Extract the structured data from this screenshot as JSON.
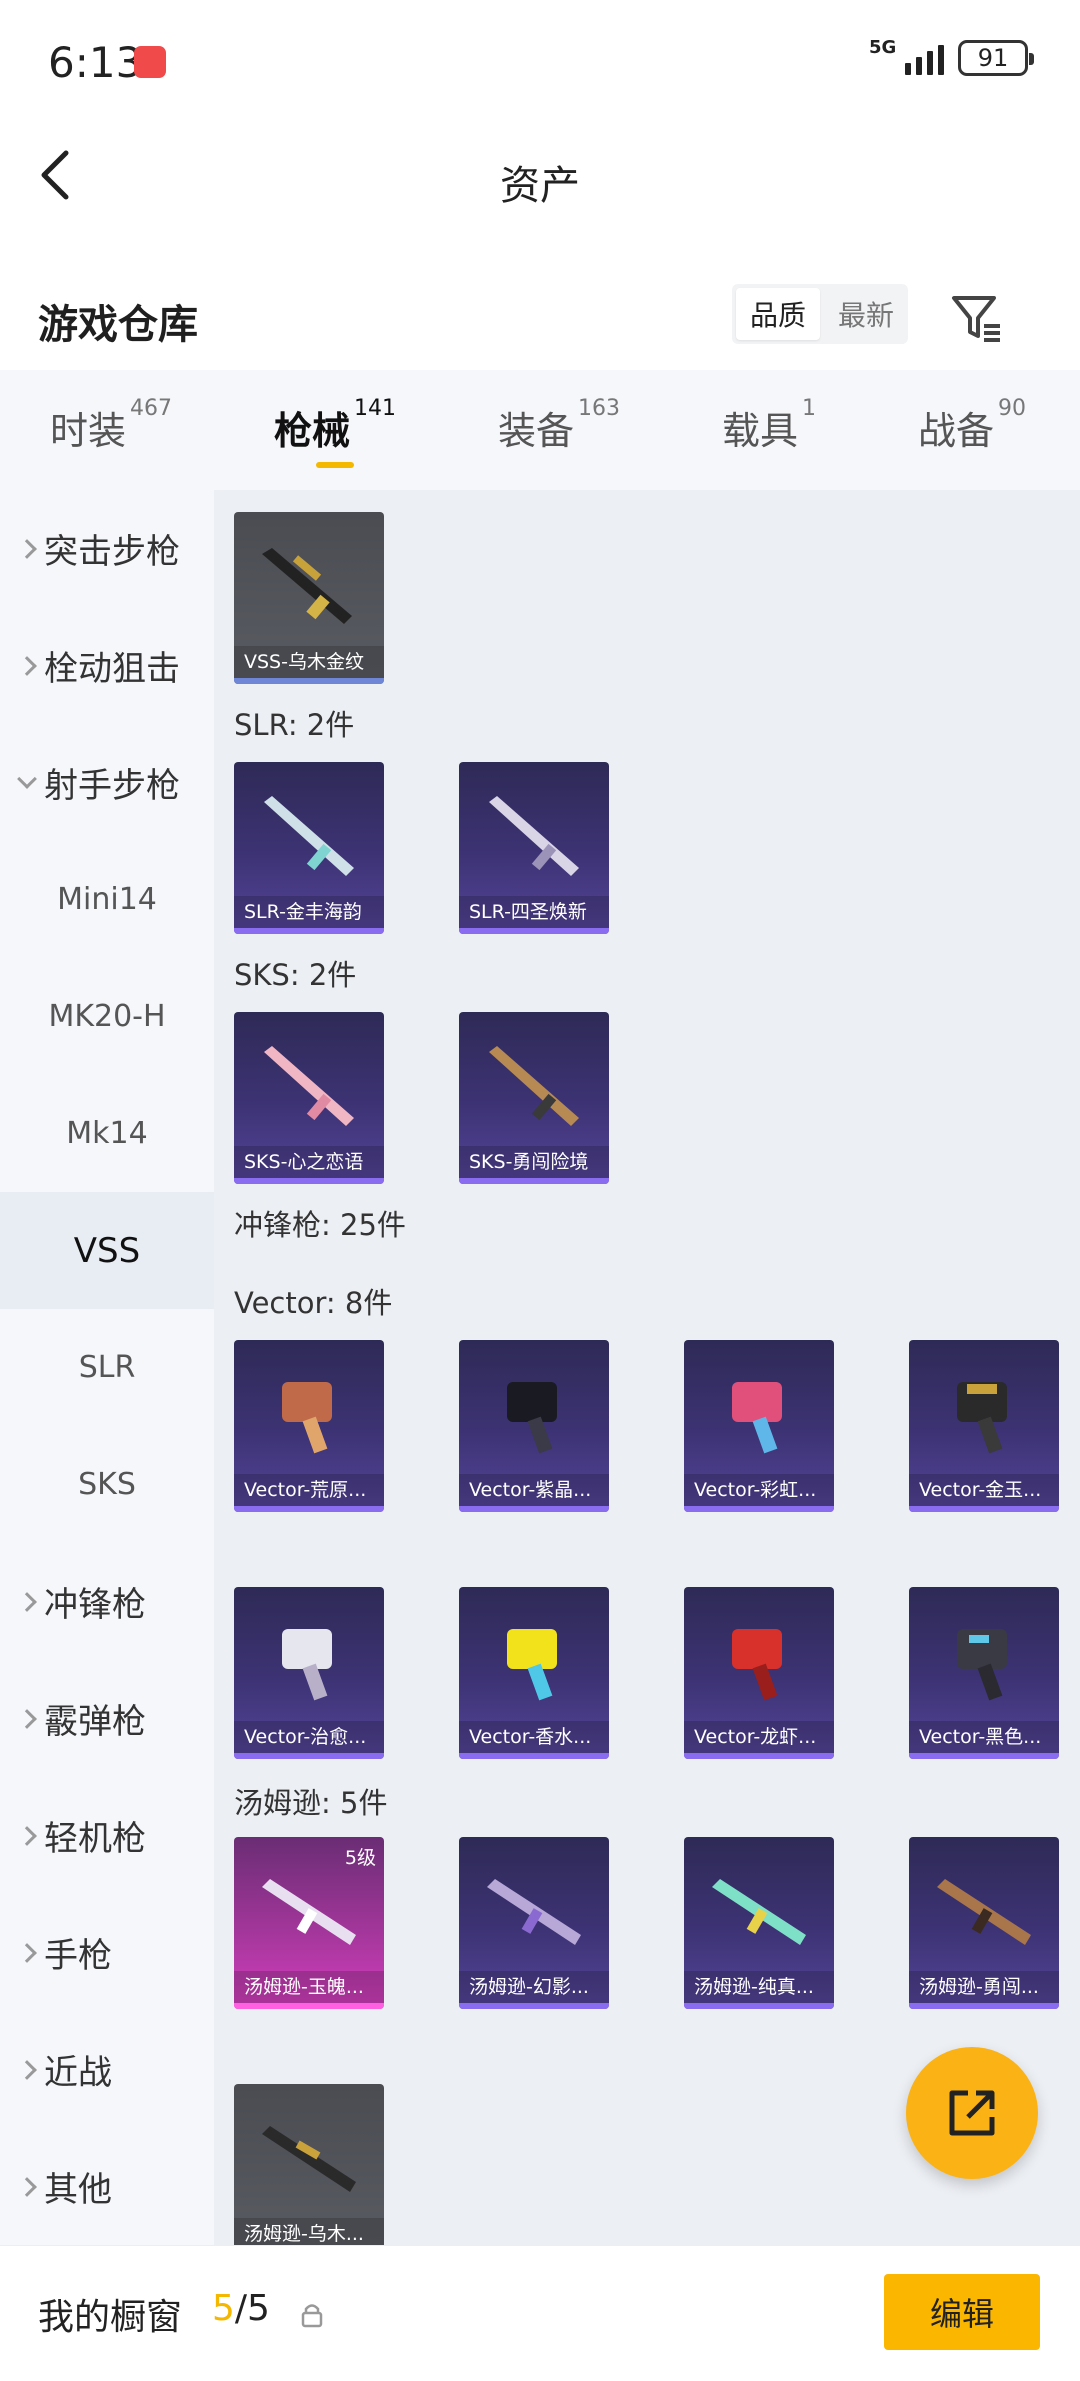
{
  "status_bar": {
    "time": "6:13",
    "network": "5G",
    "battery": "91"
  },
  "header": {
    "title": "资产"
  },
  "section": {
    "title": "游戏仓库",
    "sort_options": [
      "品质",
      "最新"
    ]
  },
  "tabs": [
    {
      "label": "时装",
      "count": "467"
    },
    {
      "label": "枪械",
      "count": "141"
    },
    {
      "label": "装备",
      "count": "163"
    },
    {
      "label": "载具",
      "count": "1"
    },
    {
      "label": "战备",
      "count": "90"
    }
  ],
  "sidebar": {
    "items": [
      "突击步枪",
      "栓动狙击",
      "射手步枪",
      "Mini14",
      "MK20-H",
      "Mk14",
      "VSS",
      "SLR",
      "SKS",
      "冲锋枪",
      "霰弹枪",
      "轻机枪",
      "手枪",
      "近战",
      "其他"
    ]
  },
  "content": {
    "vss_cards": [
      "VSS-乌木金纹"
    ],
    "slr_label": "SLR: 2件",
    "slr_cards": [
      "SLR-金丰海韵",
      "SLR-四圣焕新"
    ],
    "sks_label": "SKS: 2件",
    "sks_cards": [
      "SKS-心之恋语",
      "SKS-勇闯险境"
    ],
    "smg_label": "冲锋枪: 25件",
    "vector_label": "Vector: 8件",
    "vector_cards": [
      "Vector-荒原...",
      "Vector-紫晶...",
      "Vector-彩虹...",
      "Vector-金玉...",
      "Vector-治愈...",
      "Vector-香水...",
      "Vector-龙虾...",
      "Vector-黑色..."
    ],
    "thompson_label": "汤姆逊: 5件",
    "thompson_cards": [
      "汤姆逊-玉魄...",
      "汤姆逊-幻影...",
      "汤姆逊-纯真...",
      "汤姆逊-勇闯...",
      "汤姆逊-乌木..."
    ],
    "level_badge": "5级"
  },
  "bottom_bar": {
    "label": "我的橱窗",
    "count_current": "5",
    "count_total": "/5",
    "edit_label": "编辑"
  },
  "colors": {
    "accent": "#fbb600",
    "card_purple": "#3d3375"
  }
}
